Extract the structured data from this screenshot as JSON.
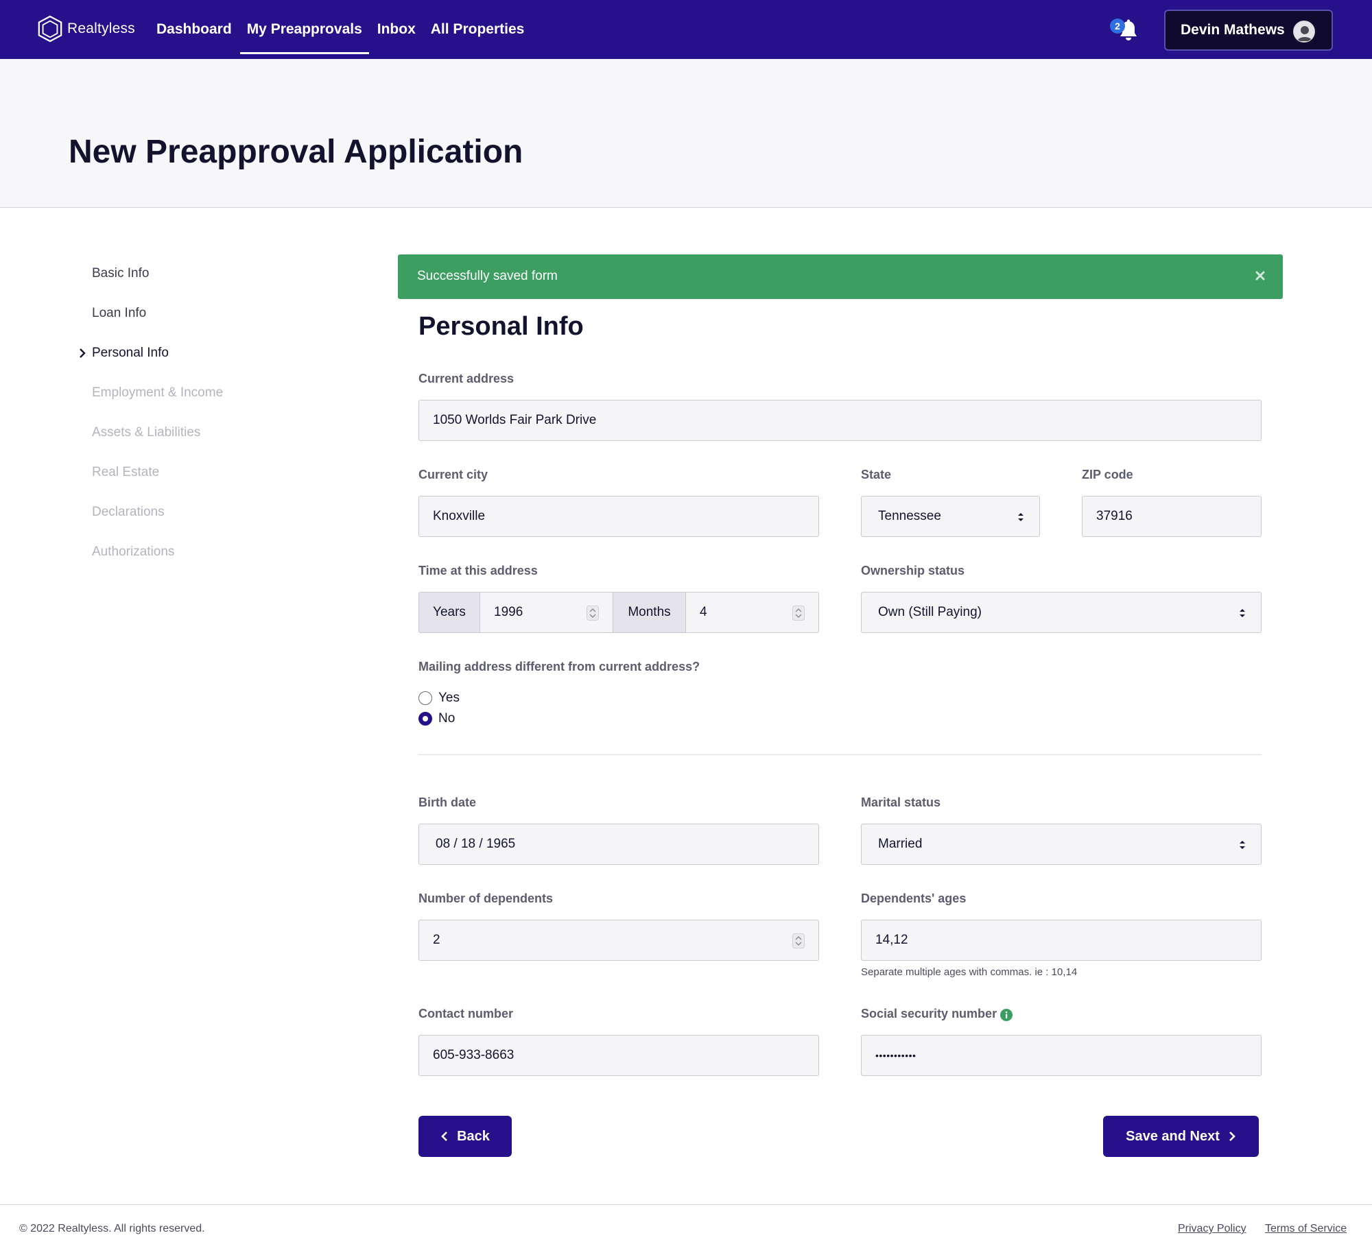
{
  "nav": {
    "brand": "Realtyless",
    "links": [
      "Dashboard",
      "My Preapprovals",
      "Inbox",
      "All Properties"
    ],
    "active_index": 1,
    "notification_count": "2",
    "user_name": "Devin Mathews"
  },
  "page": {
    "title": "New Preapproval Application"
  },
  "steps": [
    {
      "label": "Basic Info",
      "state": "completed"
    },
    {
      "label": "Loan Info",
      "state": "completed"
    },
    {
      "label": "Personal Info",
      "state": "current"
    },
    {
      "label": "Employment & Income",
      "state": "disabled"
    },
    {
      "label": "Assets & Liabilities",
      "state": "disabled"
    },
    {
      "label": "Real Estate",
      "state": "disabled"
    },
    {
      "label": "Declarations",
      "state": "disabled"
    },
    {
      "label": "Authorizations",
      "state": "disabled"
    }
  ],
  "alert": {
    "text": "Successfully saved form",
    "color": "#3d9e61"
  },
  "form": {
    "section_title": "Personal Info",
    "current_address": {
      "label": "Current address",
      "value": "1050 Worlds Fair Park Drive"
    },
    "current_city": {
      "label": "Current city",
      "value": "Knoxville"
    },
    "state": {
      "label": "State",
      "value": "Tennessee"
    },
    "zip": {
      "label": "ZIP code",
      "value": "37916"
    },
    "time_at_address": {
      "label": "Time at this address",
      "years_label": "Years",
      "years_value": "1996",
      "months_label": "Months",
      "months_value": "4"
    },
    "ownership": {
      "label": "Ownership status",
      "value": "Own (Still Paying)"
    },
    "mailing": {
      "label": "Mailing address different from current address?",
      "options": [
        "Yes",
        "No"
      ],
      "selected": "No"
    },
    "birth_date": {
      "label": "Birth date",
      "value": "08 / 18 / 1965"
    },
    "marital_status": {
      "label": "Marital status",
      "value": "Married"
    },
    "dependents": {
      "label": "Number of dependents",
      "value": "2"
    },
    "dependents_ages": {
      "label": "Dependents' ages",
      "value": "14,12",
      "help": "Separate multiple ages with commas. ie : 10,14"
    },
    "contact_number": {
      "label": "Contact number",
      "value": "605-933-8663"
    },
    "ssn": {
      "label": "Social security number",
      "value": "•••••••••••"
    },
    "back_label": "Back",
    "next_label": "Save and Next"
  },
  "footer": {
    "copyright": "© 2022 Realtyless. All rights reserved.",
    "privacy": "Privacy Policy",
    "terms": "Terms of Service"
  },
  "colors": {
    "primary": "#27118a",
    "success": "#3d9e61",
    "info": "#3d9e61"
  }
}
